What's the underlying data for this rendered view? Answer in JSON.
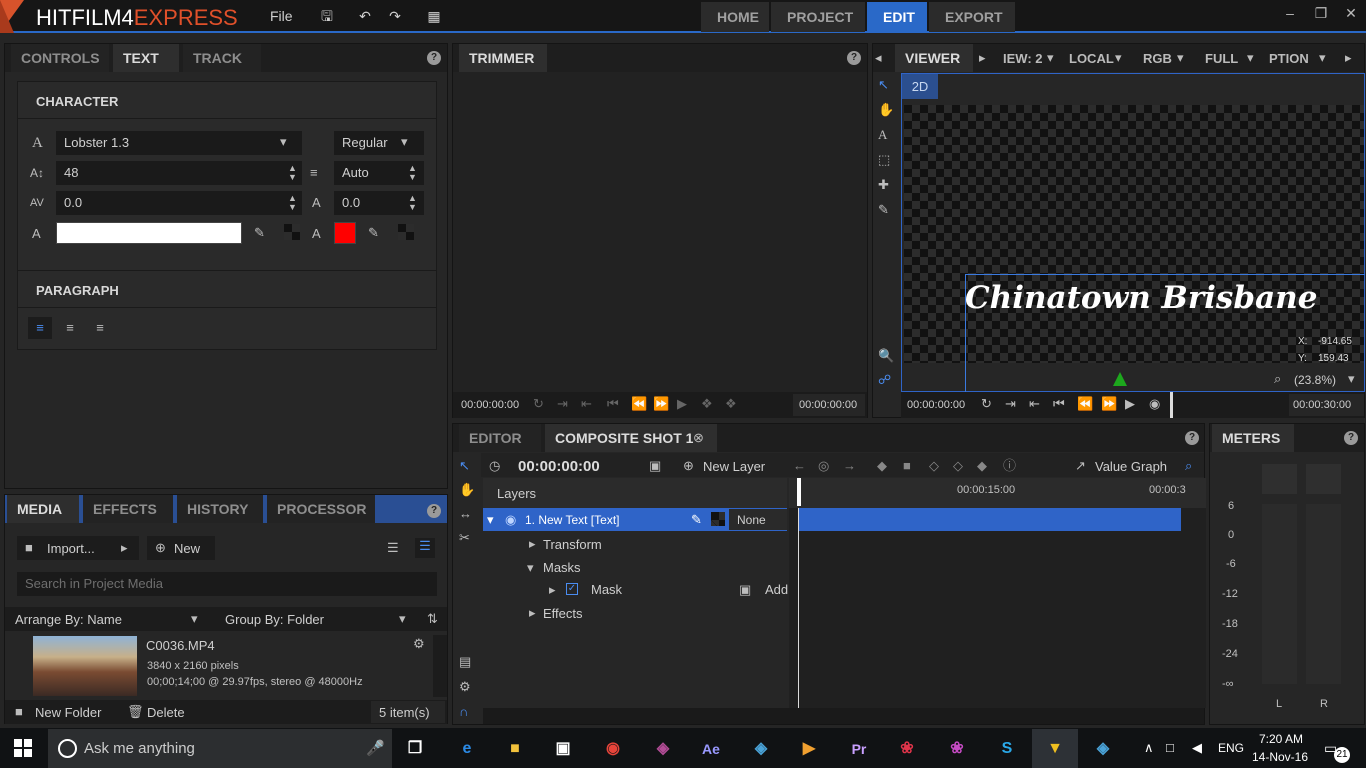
{
  "app": {
    "logo_prefix": "HITFILM4",
    "logo_suffix": "EXPRESS",
    "menu_file": "File"
  },
  "nav_tabs": [
    "HOME",
    "PROJECT",
    "EDIT",
    "EXPORT"
  ],
  "left_tabs": [
    "CONTROLS",
    "TEXT",
    "TRACK"
  ],
  "character": {
    "title": "CHARACTER",
    "font": "Lobster 1.3",
    "style": "Regular",
    "size": "48",
    "leading": "Auto",
    "tracking": "0.0",
    "baseline": "0.0",
    "fill_color": "#ffffff",
    "stroke_color": "#ff0000"
  },
  "paragraph": {
    "title": "PARAGRAPH"
  },
  "media_tabs": [
    "MEDIA",
    "EFFECTS",
    "HISTORY",
    "PROCESSOR"
  ],
  "media": {
    "import": "Import...",
    "new": "New",
    "search_placeholder": "Search in Project Media",
    "arrange": "Arrange By: Name",
    "group": "Group By: Folder",
    "file_name": "C0036.MP4",
    "file_res": "3840 x 2160 pixels",
    "file_info": "00;00;14;00 @ 29.97fps, stereo @ 48000Hz",
    "new_folder": "New Folder",
    "delete": "Delete",
    "count": "5 item(s)"
  },
  "trimmer": {
    "title": "TRIMMER",
    "tc_left": "00:00:00:00",
    "tc_right": "00:00:00:00"
  },
  "viewer": {
    "title": "VIEWER",
    "view_opt": "IEW: 2",
    "local": "LOCAL",
    "rgb": "RGB",
    "full": "FULL",
    "options": "PTION",
    "mode_2d": "2D",
    "overlay_text": "Chinatown Brisbane",
    "coord_x_label": "X:",
    "coord_x": "-914.65",
    "coord_y_label": "Y:",
    "coord_y": "159.43",
    "zoom": "(23.8%)",
    "tc_left": "00:00:00:00",
    "tc_right": "00:00:30:00"
  },
  "editor": {
    "tabs": [
      "EDITOR",
      "COMPOSITE SHOT 1"
    ],
    "timecode": "00:00:00:00",
    "new_layer": "New Layer",
    "value_graph": "Value Graph",
    "layers_label": "Layers",
    "ruler_ticks": [
      "00:00:15:00",
      "00:00:3"
    ],
    "layer_name": "1. New Text [Text]",
    "blend": "None",
    "transform": "Transform",
    "masks": "Masks",
    "mask": "Mask",
    "add": "Add",
    "effects": "Effects"
  },
  "meters": {
    "title": "METERS",
    "scale": [
      "6",
      "0",
      "-6",
      "-12",
      "-18",
      "-24",
      "-∞"
    ],
    "channels": [
      "L",
      "R"
    ]
  },
  "taskbar": {
    "search": "Ask me anything",
    "lang": "ENG",
    "time": "7:20 AM",
    "date": "14-Nov-16",
    "notif": "21"
  },
  "colors": {
    "accent": "#2a69c8",
    "logo": "#e0502a",
    "track": "#2f64c8"
  }
}
